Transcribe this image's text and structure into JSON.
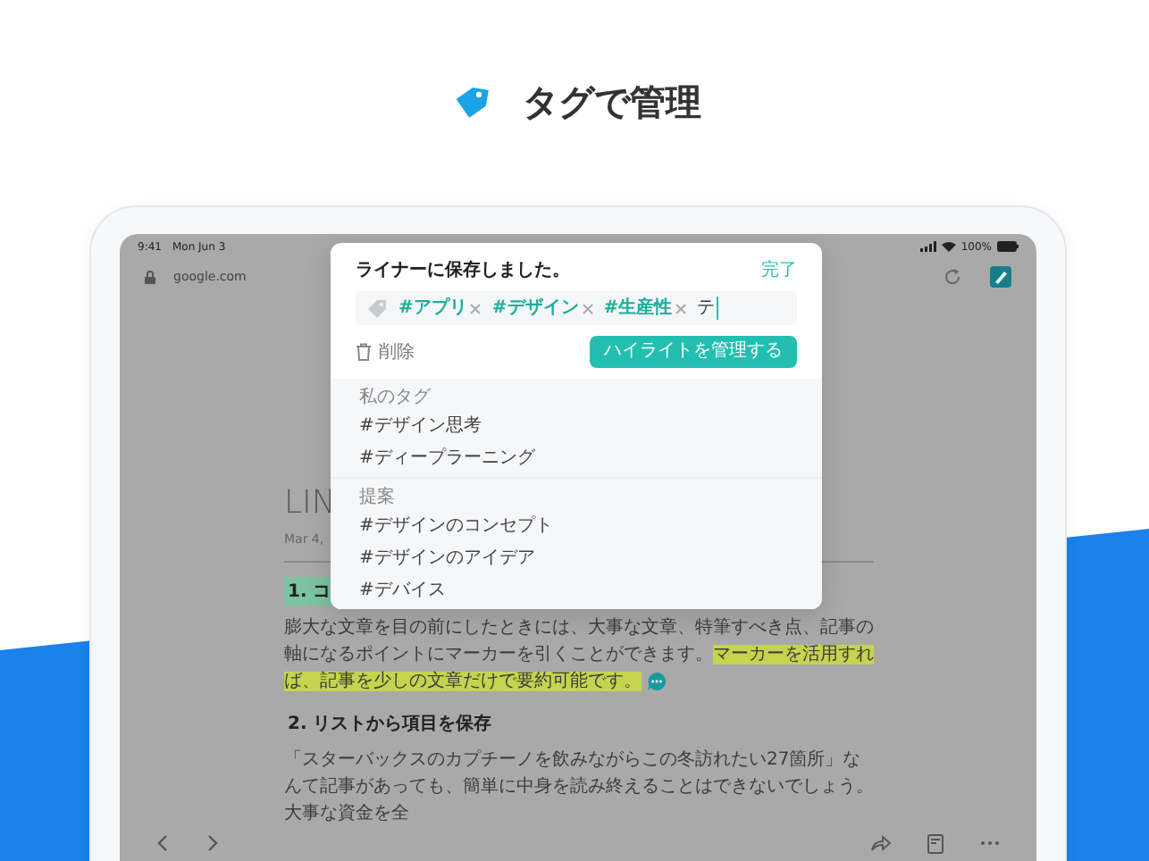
{
  "page_title": "タグで管理",
  "status_bar": {
    "time": "9:41",
    "date": "Mon Jun 3",
    "battery": "100%"
  },
  "address_bar": {
    "url": "google.com"
  },
  "article": {
    "title": "LIN",
    "date": "Mar 4,",
    "sections": [
      {
        "heading": "1. コ",
        "heading_highlighted": true,
        "comment": true,
        "paragraph": [
          {
            "text": "膨大な文章を目の前にしたときには、大事な文章、特筆すべき点、記事の軸になるポイントにマーカーを引くことができます。",
            "highlighted": false
          },
          {
            "text": "マーカーを活用すれば、記事を少しの文章だけで要約可能です。",
            "highlighted": true
          }
        ]
      },
      {
        "heading": "2. リストから項目を保存",
        "heading_highlighted": false,
        "paragraph": [
          {
            "text": "「スターバックスのカプチーノを飲みながらこの冬訪れたい27箇所」なんて記事があっても、簡単に中身を読み終えることはできないでしょう。大事な資金を全",
            "highlighted": false
          }
        ]
      }
    ]
  },
  "save_dialog": {
    "title": "ライナーに保存しました。",
    "done": "完了",
    "tags": [
      "#アプリ",
      "#デザイン",
      "#生産性"
    ],
    "input_value": "テ",
    "delete": "削除",
    "manage_button": "ハイライトを管理する",
    "groups": [
      {
        "label": "私のタグ",
        "items": [
          "#デザイン思考",
          "#ディープラーニング"
        ]
      },
      {
        "label": "提案",
        "items": [
          "#デザインのコンセプト",
          "#デザインのアイデア",
          "#デバイス"
        ]
      }
    ]
  }
}
